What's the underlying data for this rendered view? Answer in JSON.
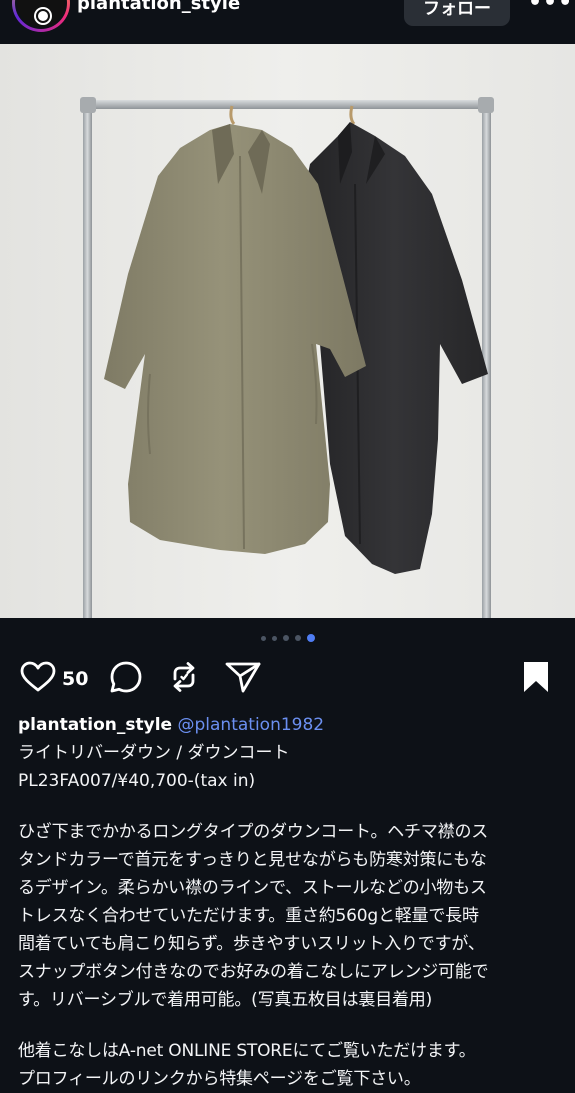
{
  "header": {
    "username": "plantation_style",
    "follow_label": "フォロー",
    "more_label": "•••"
  },
  "carousel": {
    "total": 5,
    "active_index": 5
  },
  "actions": {
    "like_count": "50"
  },
  "caption": {
    "username": "plantation_style",
    "handle": "@plantation1982",
    "product_lines": [
      "ライトリバーダウン / ダウンコート",
      "PL23FA007/¥40,700-(tax in)"
    ],
    "description_lines": [
      "ひざ下までかかるロングタイプのダウンコート。ヘチマ襟のス",
      "タンドカラーで首元をすっきりと見せながらも防寒対策にもな",
      "るデザイン。柔らかい襟のラインで、ストールなどの小物もス",
      "トレスなく合わせていただけます。重さ約560gと軽量で長時",
      "間着ていても肩こり知らず。歩きやすいスリット入りですが、",
      "スナップボタン付きなのでお好みの着こなしにアレンジ可能で",
      "す。リバーシブルで着用可能。(写真五枚目は裏目着用)"
    ],
    "footer_lines": [
      "他着こなしはA-net ONLINE STOREにてご覧いただけます。",
      "プロフィールのリンクから特集ページをご覧下さい。"
    ]
  },
  "colors": {
    "background": "#0d1117",
    "handle": "#6b8ff0",
    "active_dot": "#4f7df3",
    "coat_khaki": "#8b8770",
    "coat_black": "#2c2c2e"
  },
  "icons": [
    "heart-icon",
    "comment-icon",
    "repost-icon",
    "share-icon",
    "bookmark-icon"
  ]
}
